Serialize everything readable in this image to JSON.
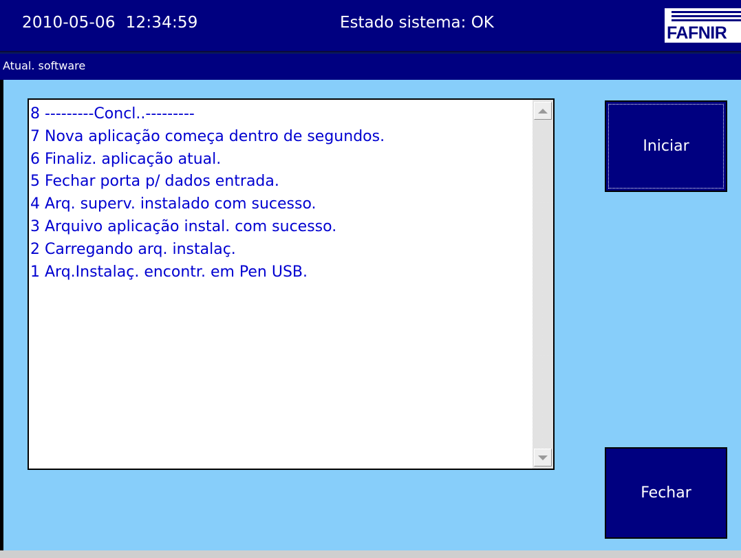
{
  "header": {
    "datetime": "2010-05-06  12:34:59",
    "system_status": "Estado sistema: OK",
    "logo_text": "FAFNIR"
  },
  "page": {
    "title": "Atual. software"
  },
  "log": {
    "lines": [
      "8 ---------Concl..---------",
      "7 Nova aplicação começa dentro de segundos.",
      "6 Finaliz. aplicação atual.",
      "5 Fechar porta p/ dados entrada.",
      "4 Arq. superv. instalado com sucesso.",
      "3 Arquivo aplicação instal. com sucesso.",
      "2 Carregando arq. instalaç.",
      "1 Arq.Instalaç. encontr. em Pen USB."
    ]
  },
  "buttons": {
    "start_label": "Iniciar",
    "close_label": "Fechar"
  },
  "colors": {
    "bar": "#000080",
    "background": "#87cefa",
    "log_text": "#0000d0"
  },
  "icons": {
    "scroll_up": "triangle-up",
    "scroll_down": "triangle-down"
  }
}
